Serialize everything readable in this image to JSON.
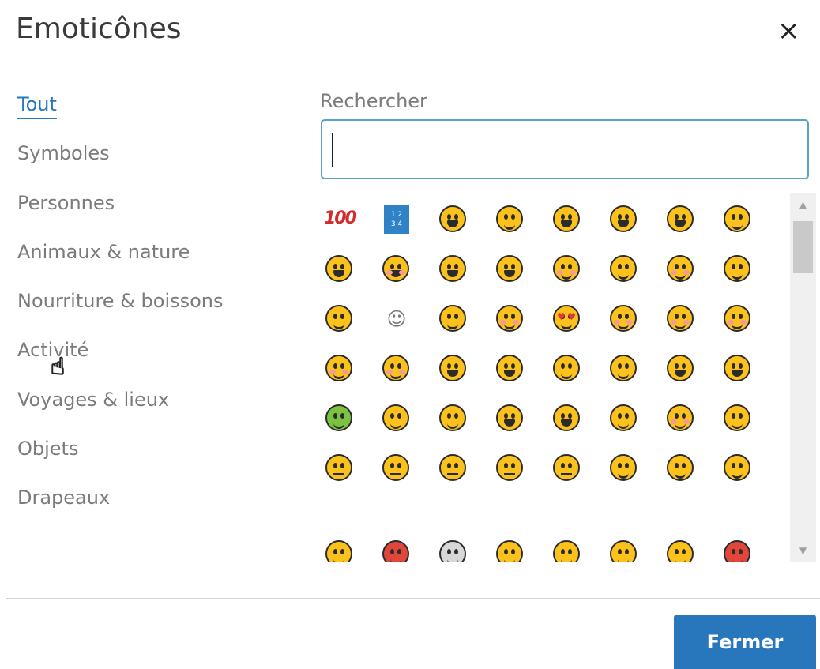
{
  "dialog": {
    "title": "Emoticônes",
    "close_label": "×",
    "ok_button": "Fermer"
  },
  "categories": [
    {
      "label": "Tout",
      "active": true
    },
    {
      "label": "Symboles",
      "active": false
    },
    {
      "label": "Personnes",
      "active": false
    },
    {
      "label": "Animaux & nature",
      "active": false
    },
    {
      "label": "Nourriture & boissons",
      "active": false
    },
    {
      "label": "Activité",
      "active": false
    },
    {
      "label": "Voyages & lieux",
      "active": false
    },
    {
      "label": "Objets",
      "active": false
    },
    {
      "label": "Drapeaux",
      "active": false
    }
  ],
  "search": {
    "label": "Rechercher",
    "value": "",
    "placeholder": ""
  },
  "emoji_rows": [
    [
      "hundred-points",
      "input-numbers",
      "grinning-face",
      "grimacing-face",
      "beaming-face",
      "face-with-tears-of-joy",
      "rolling-on-the-floor-laughing",
      "face-with-sweat"
    ],
    [
      "grinning-face-big-eyes",
      "grinning-face-smiling-eyes",
      "grinning-face-with-sweat",
      "squinting-face",
      "smiling-face-with-halo",
      "winking-face",
      "smiling-face-smiling-eyes",
      "slightly-smiling-face"
    ],
    [
      "upside-down-face",
      "white-smiling-face",
      "face-savoring-food",
      "relieved-face",
      "heart-eyes",
      "smiling-face-with-hearts",
      "face-blowing-kiss",
      "kissing-face"
    ],
    [
      "kissing-smiling-eyes",
      "kissing-closed-eyes",
      "winking-tongue",
      "zany-face",
      "face-raised-eyebrow",
      "face-with-monocle",
      "squinting-tongue",
      "face-with-tongue"
    ],
    [
      "money-mouth-face",
      "nerd-face",
      "smiling-face-sunglasses",
      "star-struck",
      "clown-face",
      "cowboy-hat-face",
      "hugging-face",
      "smirking-face"
    ],
    [
      "face-without-mouth",
      "neutral-face",
      "expressionless-face",
      "unamused-face",
      "face-rolling-eyes",
      "thinking-face",
      "confused-face",
      "face-hand-over-mouth"
    ],
    [
      "face-partial-1",
      "angry-face",
      "skull-face",
      "face-partial-4",
      "face-partial-5",
      "face-partial-6",
      "face-partial-7",
      "pouting-face"
    ]
  ],
  "scrollbar": {
    "up_icon": "▲",
    "down_icon": "▼",
    "position_fraction": 0.0
  },
  "colors": {
    "accent": "#2877bd",
    "active_link": "#2778b8",
    "search_border": "#5aa2c7",
    "emoji_yellow": "#fcc21b"
  }
}
